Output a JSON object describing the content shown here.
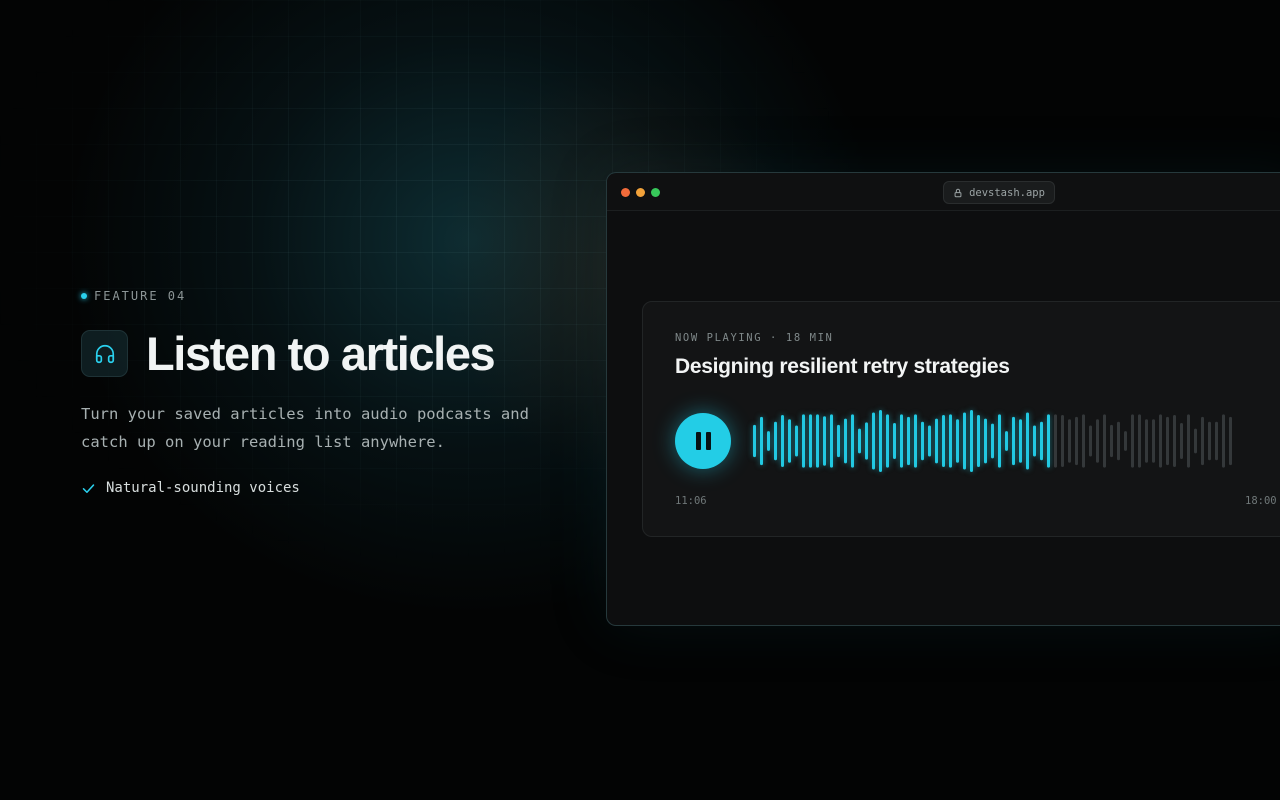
{
  "feature": {
    "label": "FEATURE 04",
    "headline": "Listen to articles",
    "icon": "headphones-icon",
    "description": "Turn your saved articles into audio podcasts and catch up on your reading list anywhere.",
    "bullets": [
      {
        "label": "Natural-sounding voices",
        "icon": "check-icon"
      }
    ]
  },
  "browser": {
    "url": "devstash.app",
    "url_icon": "lock-icon"
  },
  "player": {
    "meta": "NOW PLAYING · 18 MIN",
    "title": "Designing resilient retry strategies",
    "state": "playing",
    "control_icon": "pause-icon",
    "current_time": "11:06",
    "total_time": "18:00",
    "progress": 0.62,
    "waveform_levels": [
      0.52,
      0.78,
      0.32,
      0.62,
      0.84,
      0.7,
      0.5,
      0.86,
      0.86,
      0.86,
      0.8,
      0.86,
      0.52,
      0.72,
      0.86,
      0.4,
      0.6,
      0.92,
      1.0,
      0.86,
      0.58,
      0.86,
      0.78,
      0.86,
      0.62,
      0.5,
      0.72,
      0.84,
      0.86,
      0.7,
      0.92,
      1.0,
      0.84,
      0.72,
      0.56,
      0.86,
      0.32,
      0.78,
      0.7,
      0.92,
      0.5,
      0.62,
      0.86,
      0.86,
      0.84,
      0.7,
      0.78,
      0.86,
      0.5,
      0.7,
      0.86,
      0.52,
      0.62,
      0.32,
      0.86,
      0.86,
      0.7,
      0.7,
      0.86,
      0.78,
      0.84,
      0.58,
      0.86,
      0.4,
      0.78,
      0.62,
      0.62,
      0.86,
      0.78
    ],
    "colors": {
      "accent": "#23cde6",
      "played_bar": "#22c9e2",
      "unplayed_bar": "#34383a"
    }
  }
}
